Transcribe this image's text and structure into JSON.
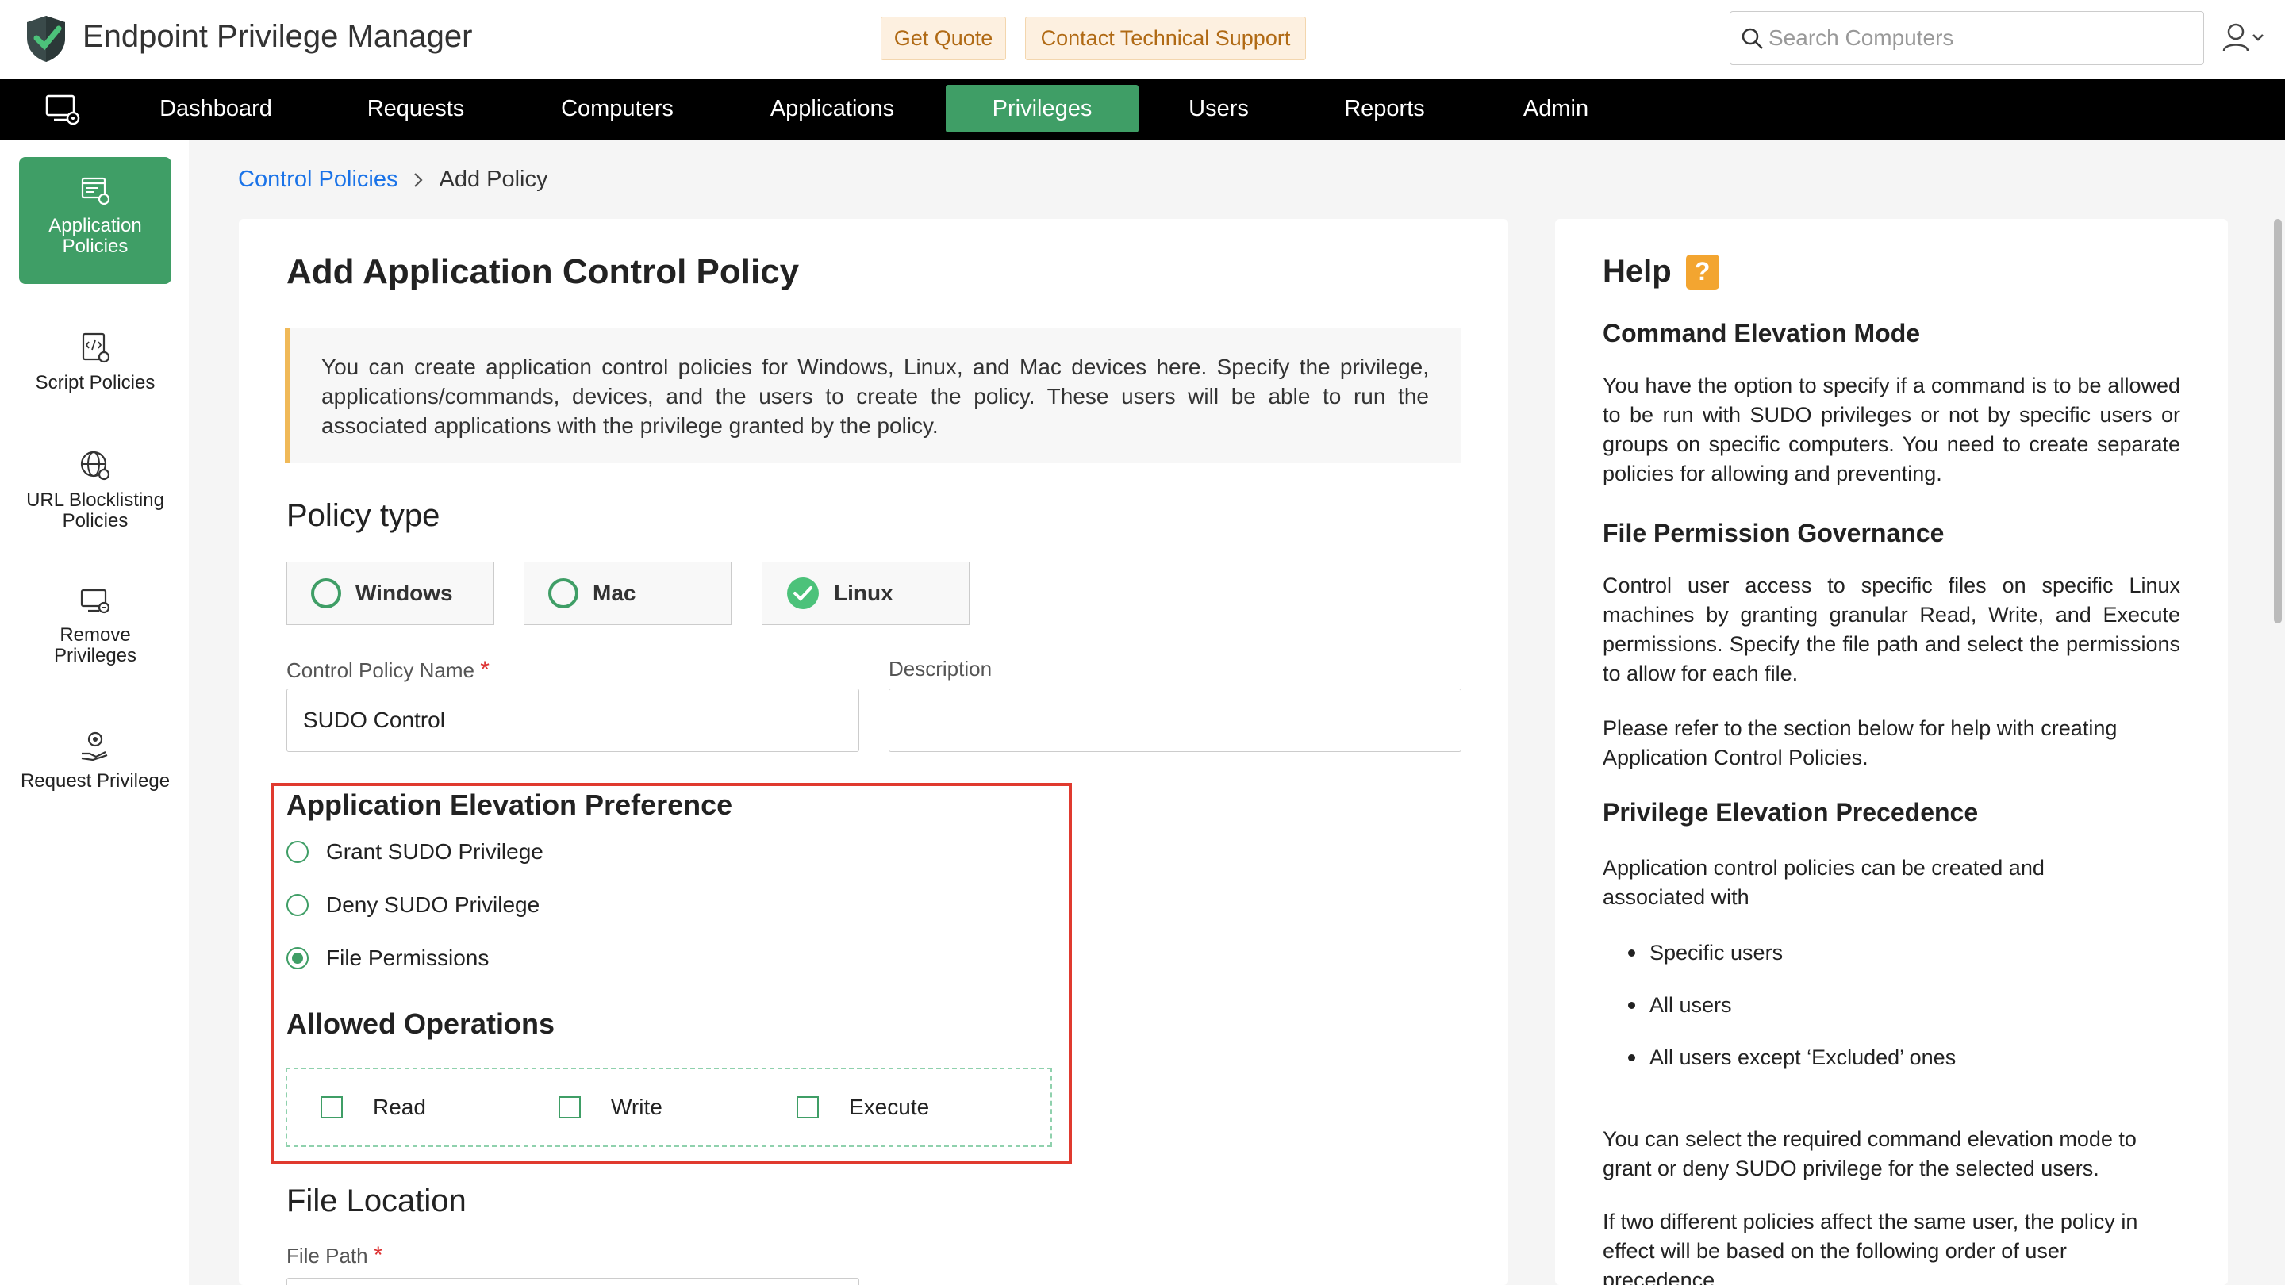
{
  "app": {
    "title": "Endpoint Privilege Manager",
    "get_quote": "Get Quote",
    "contact_support": "Contact Technical Support",
    "search_placeholder": "Search Computers"
  },
  "nav": {
    "items": [
      "Dashboard",
      "Requests",
      "Computers",
      "Applications",
      "Privileges",
      "Users",
      "Reports",
      "Admin"
    ],
    "active": "Privileges"
  },
  "sidebar": {
    "items": [
      {
        "label_line1": "Application",
        "label_line2": "Policies",
        "icon": "application-policy-icon"
      },
      {
        "label_line1": "Script Policies",
        "label_line2": "",
        "icon": "script-policy-icon"
      },
      {
        "label_line1": "URL Blocklisting",
        "label_line2": "Policies",
        "icon": "globe-icon"
      },
      {
        "label_line1": "Remove",
        "label_line2": "Privileges",
        "icon": "remove-privilege-icon"
      },
      {
        "label_line1": "Request Privilege",
        "label_line2": "",
        "icon": "request-privilege-icon"
      }
    ]
  },
  "breadcrumb": {
    "link": "Control Policies",
    "current": "Add Policy"
  },
  "form": {
    "title": "Add Application Control Policy",
    "info": "You can create application control policies for Windows, Linux, and Mac devices here. Specify the privilege, applications/commands, devices, and the users to create the policy. These users will be able to run the associated applications with the privilege granted by the policy.",
    "policy_type_heading": "Policy type",
    "policy_types": [
      "Windows",
      "Mac",
      "Linux"
    ],
    "selected_policy_type": "Linux",
    "name_label": "Control Policy Name",
    "required_mark": "*",
    "name_value": "SUDO Control",
    "description_label": "Description",
    "description_value": "",
    "elevation_heading": "Application Elevation Preference",
    "elevation_options": [
      "Grant SUDO Privilege",
      "Deny SUDO Privilege",
      "File Permissions"
    ],
    "selected_elevation": "File Permissions",
    "operations_heading": "Allowed Operations",
    "operations": [
      "Read",
      "Write",
      "Execute"
    ],
    "file_location_heading": "File Location",
    "file_path_label": "File Path"
  },
  "help": {
    "title": "Help",
    "q_mark": "?",
    "h1": "Command Elevation Mode",
    "p1": "You have the option to specify if a command is to be allowed to be run with SUDO privileges or not by specific users or groups on specific computers. You need to create separate policies for allowing and preventing.",
    "h2": "File Permission Governance",
    "p2": "Control user access to specific files on specific Linux machines by granting granular Read, Write, and Execute permissions. Specify the file path and select the permissions to allow for each file.",
    "p3": "Please refer to the section below for help with creating Application Control Policies.",
    "h3": "Privilege Elevation Precedence",
    "p4": "Application control policies can be created and associated with",
    "list": [
      "Specific users",
      "All users",
      "All users except ‘Excluded’ ones"
    ],
    "p5": "You can select the required command elevation mode to grant or deny SUDO privilege for the selected users.",
    "p6": "If two different policies affect the same user, the policy in effect will be based on the following order of user precedence."
  }
}
